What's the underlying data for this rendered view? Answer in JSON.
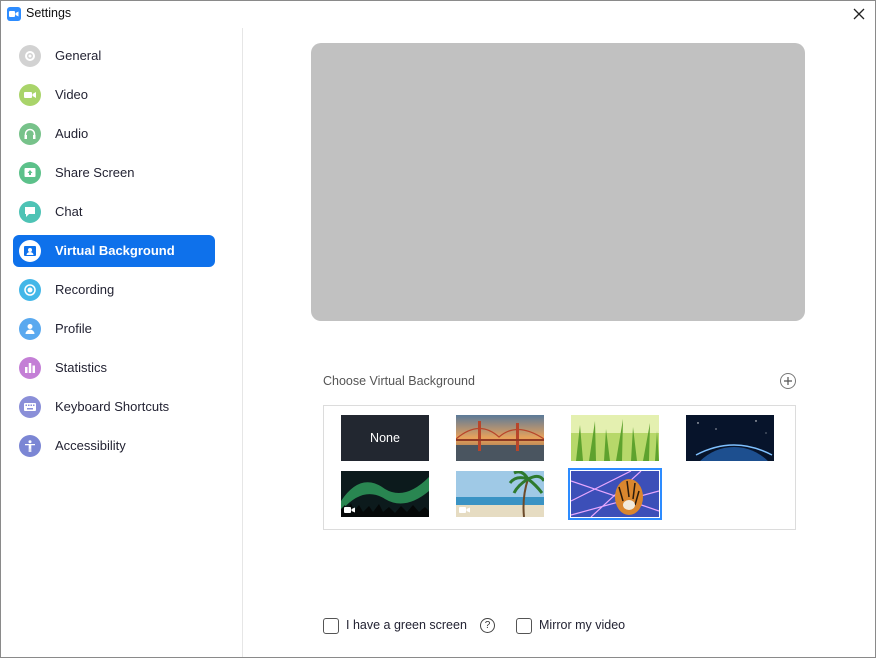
{
  "window": {
    "title": "Settings"
  },
  "sidebar": {
    "items": [
      {
        "label": "General",
        "icon": "gear-icon",
        "color": "#d2d2d2",
        "active": false
      },
      {
        "label": "Video",
        "icon": "video-camera-icon",
        "color": "#a9d46a",
        "active": false
      },
      {
        "label": "Audio",
        "icon": "headphones-icon",
        "color": "#77c28a",
        "active": false
      },
      {
        "label": "Share Screen",
        "icon": "share-screen-icon",
        "color": "#5cc18a",
        "active": false
      },
      {
        "label": "Chat",
        "icon": "chat-bubble-icon",
        "color": "#4ec3b5",
        "active": false
      },
      {
        "label": "Virtual Background",
        "icon": "person-card-icon",
        "color": "#ffffff",
        "active": true
      },
      {
        "label": "Recording",
        "icon": "record-icon",
        "color": "#43b7e8",
        "active": false
      },
      {
        "label": "Profile",
        "icon": "person-icon",
        "color": "#5aa9ef",
        "active": false
      },
      {
        "label": "Statistics",
        "icon": "bar-chart-icon",
        "color": "#c47fd6",
        "active": false
      },
      {
        "label": "Keyboard Shortcuts",
        "icon": "keyboard-icon",
        "color": "#8a8fd8",
        "active": false
      },
      {
        "label": "Accessibility",
        "icon": "accessibility-icon",
        "color": "#7b86d4",
        "active": false
      }
    ],
    "active_color": "#0e71eb"
  },
  "main": {
    "section_title": "Choose Virtual Background",
    "backgrounds": [
      {
        "label": "None",
        "type": "none",
        "selected": false
      },
      {
        "label": "",
        "type": "golden-gate-bridge",
        "selected": false
      },
      {
        "label": "",
        "type": "grass",
        "selected": false
      },
      {
        "label": "",
        "type": "earth-from-space",
        "selected": false
      },
      {
        "label": "",
        "type": "aurora-video",
        "selected": false
      },
      {
        "label": "",
        "type": "beach-video",
        "selected": false
      },
      {
        "label": "",
        "type": "tiger-laser",
        "selected": true
      }
    ],
    "green_screen_label": "I have a green screen",
    "mirror_label": "Mirror my video"
  }
}
